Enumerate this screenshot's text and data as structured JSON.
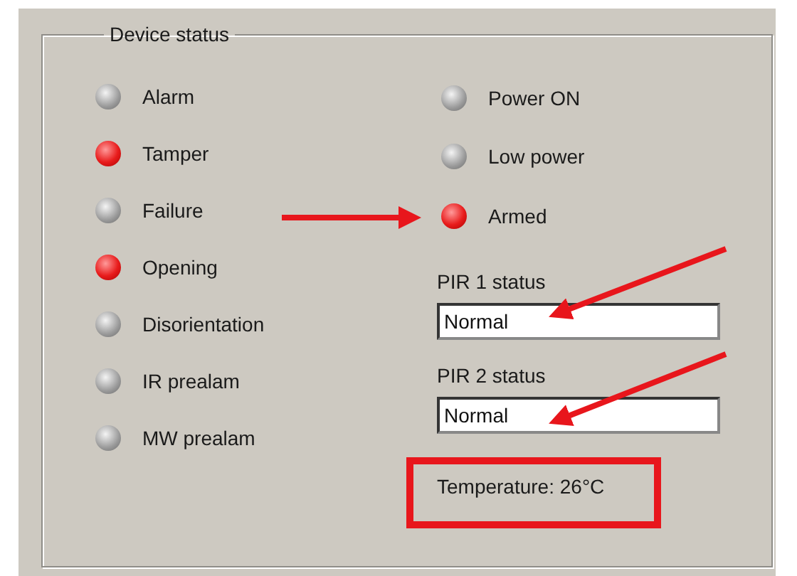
{
  "group": {
    "title": "Device status"
  },
  "left_indicators": [
    {
      "label": "Alarm",
      "on": false
    },
    {
      "label": "Tamper",
      "on": true
    },
    {
      "label": "Failure",
      "on": false
    },
    {
      "label": "Opening",
      "on": true
    },
    {
      "label": "Disorientation",
      "on": false
    },
    {
      "label": "IR prealam",
      "on": false
    },
    {
      "label": "MW prealam",
      "on": false
    }
  ],
  "right_indicators": [
    {
      "label": "Power ON",
      "on": false
    },
    {
      "label": "Low power",
      "on": false
    },
    {
      "label": "Armed",
      "on": true
    }
  ],
  "fields": [
    {
      "label": "PIR 1 status",
      "value": "Normal"
    },
    {
      "label": "PIR 2 status",
      "value": "Normal"
    }
  ],
  "temperature": "Temperature: 26°C"
}
